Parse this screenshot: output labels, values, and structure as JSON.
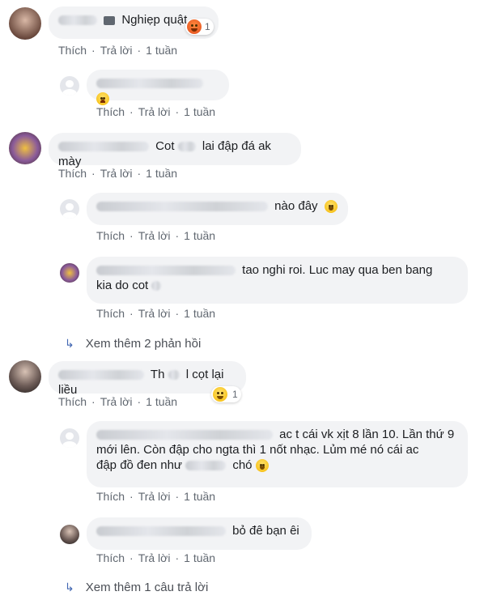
{
  "colors": {
    "bubble_bg": "#f2f3f5",
    "action_text": "#606770",
    "link_blue": "#4267b2",
    "angry_reaction": "#e24a1b",
    "haha_reaction": "#f5b700"
  },
  "actions": {
    "like": "Thích",
    "reply": "Trả lời",
    "time": "1 tuần",
    "sep": "·"
  },
  "comments": [
    {
      "text": "Nghiẹp quật",
      "reaction_count": "1",
      "reaction_icon": "angry-face-icon"
    },
    {
      "text": "Cot",
      "text2": "lai đập đá ak mày"
    },
    {
      "text": "Th",
      "text2": "l cọt lại liều",
      "reaction_count": "1",
      "reaction_icon": "laughing-face-icon"
    }
  ],
  "replies": [
    {
      "text": "",
      "emoji": "sad-face-icon"
    },
    {
      "text": "nào đây",
      "emoji": "rofl-emoji-icon"
    },
    {
      "text": "tao nghi roi. Luc may qua ben bang",
      "text2": "kia do cot"
    },
    {
      "text": "ac t cái vk xịt 8 lần 10. Lần thứ 9",
      "text2": "mới lên. Còn đập cho ngta thì 1 nốt nhạc. Lủm mé nó cái ac",
      "text3": "đập đồ đen như",
      "text4": "chó"
    },
    {
      "text": "bỏ đê bạn êi"
    }
  ],
  "see_more": [
    {
      "label": "Xem thêm 2 phản hồi",
      "arrow": "↳"
    },
    {
      "label": "Xem thêm 1 câu trả lời",
      "arrow": "↳"
    }
  ]
}
